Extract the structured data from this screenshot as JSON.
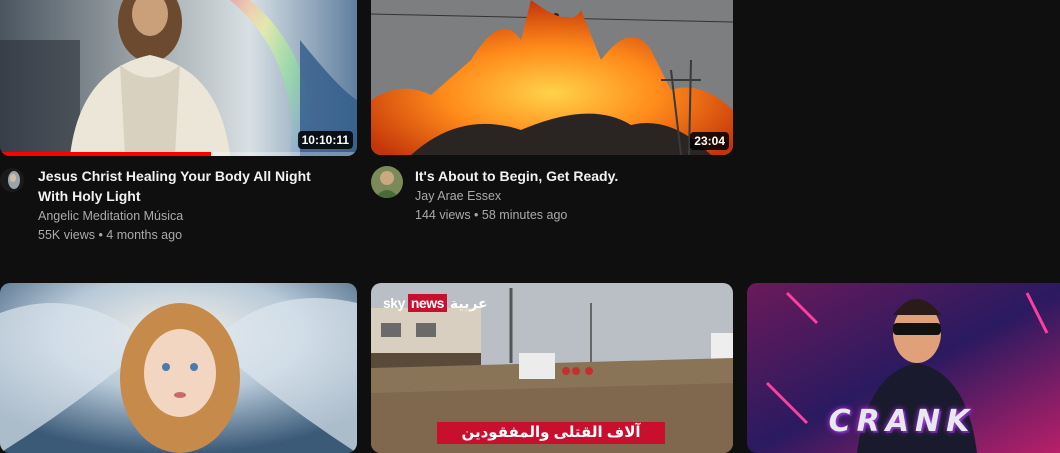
{
  "videos": [
    {
      "title": "Jesus Christ Healing Your Body All Night With Holy Light",
      "channel": "Angelic Meditation Música",
      "stats": "55K views • 4 months ago",
      "duration": "10:10:11",
      "watch_progress": 0.59
    },
    {
      "title": "It's About to Begin, Get Ready.",
      "channel": "Jay Arae Essex",
      "stats": "144 views • 58 minutes ago",
      "duration": "23:04"
    },
    {
      "brand_sky": "sky",
      "brand_news": "news",
      "brand_arabic": "عربية",
      "caption": "آلاف القتلى والمفقودين"
    },
    {
      "overlay_text": "CRANK"
    }
  ],
  "colors": {
    "background": "#0f0f0f",
    "progress": "#ff0000",
    "news_red": "#c8102e"
  }
}
